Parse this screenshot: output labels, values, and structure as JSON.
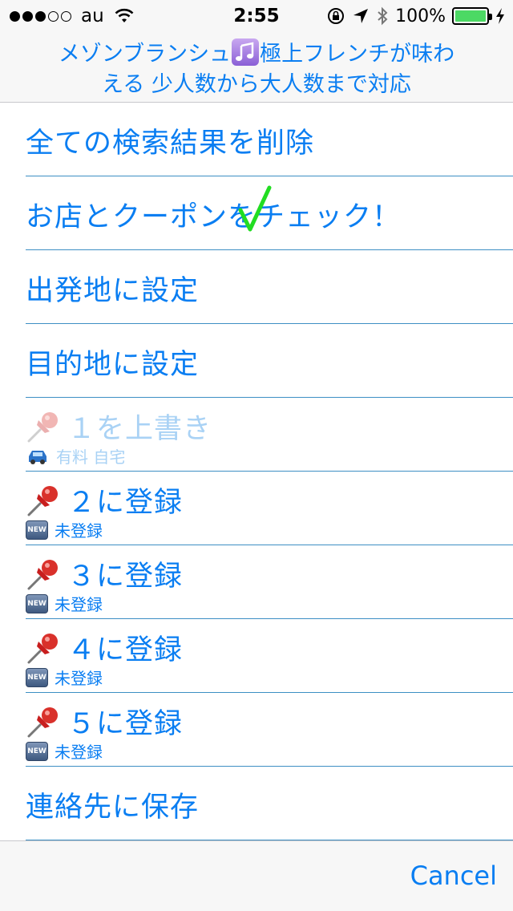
{
  "status_bar": {
    "carrier": "au",
    "time": "2:55",
    "battery_percent": "100%"
  },
  "header": {
    "title_part1": "メゾンブランシュ",
    "title_part2": "極上フレンチが味わ",
    "title_line2": "える 少人数から大人数まで対応"
  },
  "menu": {
    "delete_all": "全ての検索結果を削除",
    "check_shop": "お店とクーポンをチェック！",
    "set_origin": "出発地に設定",
    "set_destination": "目的地に設定",
    "favorites": [
      {
        "label": "１を上書き",
        "sub": "有料 自宅",
        "disabled": true
      },
      {
        "label": "２に登録",
        "sub": "未登録",
        "disabled": false
      },
      {
        "label": "３に登録",
        "sub": "未登録",
        "disabled": false
      },
      {
        "label": "４に登録",
        "sub": "未登録",
        "disabled": false
      },
      {
        "label": "５に登録",
        "sub": "未登録",
        "disabled": false
      }
    ],
    "save_contact": "連絡先に保存"
  },
  "badge": {
    "new_text": "NEW"
  },
  "footer": {
    "cancel_label": "Cancel"
  },
  "colors": {
    "accent": "#0a7ef2",
    "check": "#22dd22",
    "battery": "#4cd964"
  }
}
